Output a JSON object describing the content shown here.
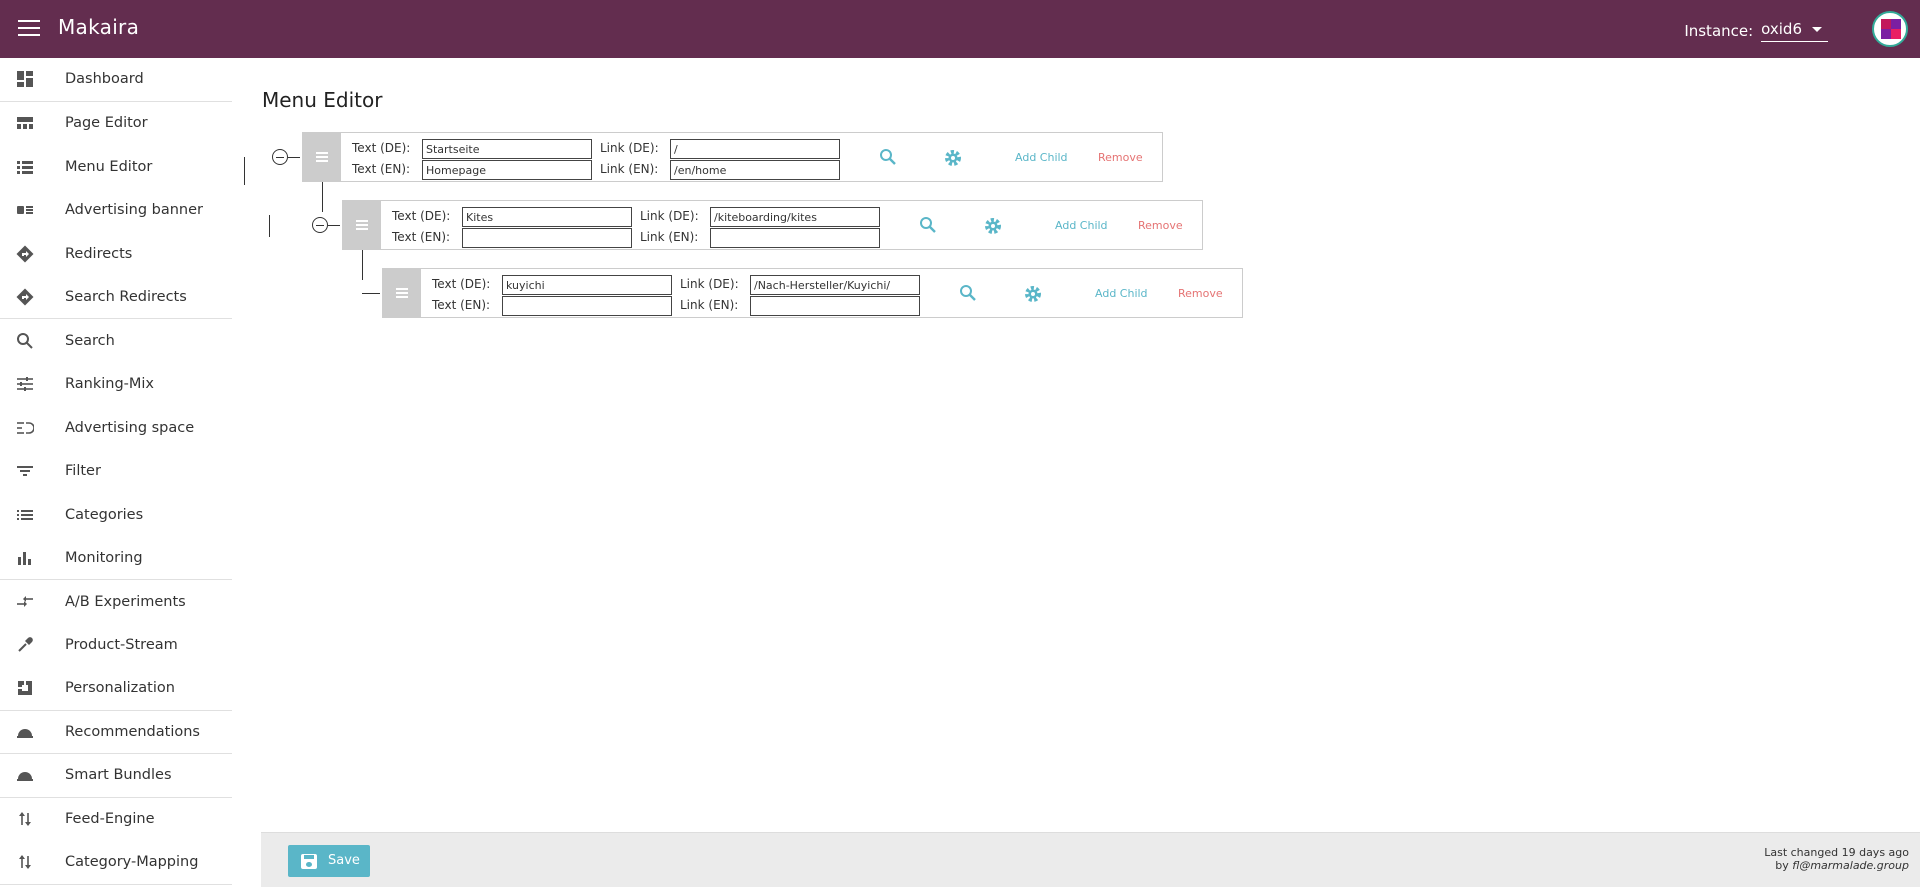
{
  "app": {
    "brand": "Makaira"
  },
  "instance": {
    "label": "Instance:",
    "value": "oxid6"
  },
  "sidebar": {
    "items": [
      {
        "label": "Dashboard"
      },
      {
        "label": "Page Editor"
      },
      {
        "label": "Menu Editor"
      },
      {
        "label": "Advertising banner"
      },
      {
        "label": "Redirects"
      },
      {
        "label": "Search Redirects"
      },
      {
        "label": "Search"
      },
      {
        "label": "Ranking-Mix"
      },
      {
        "label": "Advertising space"
      },
      {
        "label": "Filter"
      },
      {
        "label": "Categories"
      },
      {
        "label": "Monitoring"
      },
      {
        "label": "A/B Experiments"
      },
      {
        "label": "Product-Stream"
      },
      {
        "label": "Personalization"
      },
      {
        "label": "Recommendations"
      },
      {
        "label": "Smart Bundles"
      },
      {
        "label": "Feed-Engine"
      },
      {
        "label": "Category-Mapping"
      }
    ]
  },
  "page": {
    "title": "Menu Editor"
  },
  "labels": {
    "text_de": "Text (DE):",
    "text_en": "Text (EN):",
    "link_de": "Link (DE):",
    "link_en": "Link (EN):",
    "add_child": "Add Child",
    "remove": "Remove"
  },
  "nodes": [
    {
      "text_de": "Startseite",
      "text_en": "Homepage",
      "link_de": "/",
      "link_en": "/en/home"
    },
    {
      "text_de": "Kites",
      "text_en": "",
      "link_de": "/kiteboarding/kites",
      "link_en": ""
    },
    {
      "text_de": "kuyichi",
      "text_en": "",
      "link_de": "/Nach-Hersteller/Kuyichi/",
      "link_en": ""
    }
  ],
  "footer": {
    "save_label": "Save",
    "last_changed": "Last changed 19 days ago",
    "by_prefix": "by",
    "by_user": "fl@marmalade.group"
  },
  "colors": {
    "topbar": "#632d4f",
    "accent": "#5ab6c8",
    "remove": "#e57373"
  }
}
